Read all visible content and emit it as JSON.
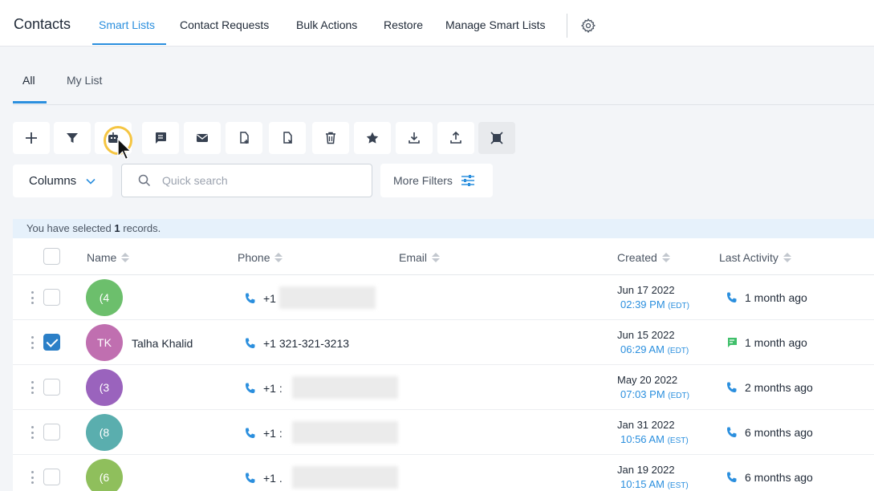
{
  "topnav": {
    "title": "Contacts",
    "tabs": [
      {
        "label": "Smart Lists",
        "active": true
      },
      {
        "label": "Contact Requests"
      },
      {
        "label": "Bulk Actions"
      },
      {
        "label": "Restore"
      },
      {
        "label": "Manage Smart Lists"
      }
    ],
    "settings_icon": "gear-icon"
  },
  "subtabs": [
    {
      "label": "All",
      "active": true
    },
    {
      "label": "My List"
    }
  ],
  "toolbar": {
    "buttons": [
      {
        "icon": "plus-icon"
      },
      {
        "icon": "filter-icon"
      },
      {
        "icon": "automation-icon",
        "highlighted": true
      },
      {
        "icon": "message-icon"
      },
      {
        "icon": "email-icon"
      },
      {
        "icon": "tag-add-icon"
      },
      {
        "icon": "tag-remove-icon"
      },
      {
        "icon": "trash-icon"
      },
      {
        "icon": "star-icon"
      },
      {
        "icon": "download-icon"
      },
      {
        "icon": "upload-icon"
      },
      {
        "icon": "merge-icon"
      }
    ]
  },
  "filters": {
    "columns_label": "Columns",
    "search_placeholder": "Quick search",
    "more_filters_label": "More Filters"
  },
  "selection": {
    "prefix": "You have selected",
    "count": "1",
    "suffix": "records."
  },
  "table": {
    "headers": [
      "Name",
      "Phone",
      "Email",
      "Created",
      "Last Activity"
    ],
    "rows": [
      {
        "checked": false,
        "initials": "(4",
        "avatar_color": "#6cbf6c",
        "name": "",
        "phone": "+1",
        "phone_blurred": true,
        "created_date": "Jun 17 2022",
        "created_time": "02:39 PM",
        "tz": "(EDT)",
        "activity_icon": "phone-icon",
        "activity": "1 month ago"
      },
      {
        "checked": true,
        "initials": "TK",
        "avatar_color": "#c06fb0",
        "name": "Talha Khalid",
        "phone": "+1 321-321-3213",
        "phone_blurred": false,
        "created_date": "Jun 15 2022",
        "created_time": "06:29 AM",
        "tz": "(EDT)",
        "activity_icon": "sms-icon",
        "activity": "1 month ago"
      },
      {
        "checked": false,
        "initials": "(3",
        "avatar_color": "#9a63bd",
        "name": "",
        "phone": "+1 :",
        "phone_blurred": true,
        "created_date": "May 20 2022",
        "created_time": "07:03 PM",
        "tz": "(EDT)",
        "activity_icon": "phone-icon",
        "activity": "2 months ago"
      },
      {
        "checked": false,
        "initials": "(8",
        "avatar_color": "#5aaeae",
        "name": "",
        "phone": "+1 :",
        "phone_blurred": true,
        "created_date": "Jan 31 2022",
        "created_time": "10:56 AM",
        "tz": "(EST)",
        "activity_icon": "phone-icon",
        "activity": "6 months ago"
      },
      {
        "checked": false,
        "initials": "(6",
        "avatar_color": "#8fbf5c",
        "name": "",
        "phone": "+1 .",
        "phone_blurred": true,
        "created_date": "Jan 19 2022",
        "created_time": "10:15 AM",
        "tz": "(EST)",
        "activity_icon": "phone-icon",
        "activity": "6 months ago"
      }
    ]
  },
  "colors": {
    "accent": "#2b8fde",
    "highlight_ring": "#f5c542",
    "checkbox_checked": "#2b7fc7"
  }
}
